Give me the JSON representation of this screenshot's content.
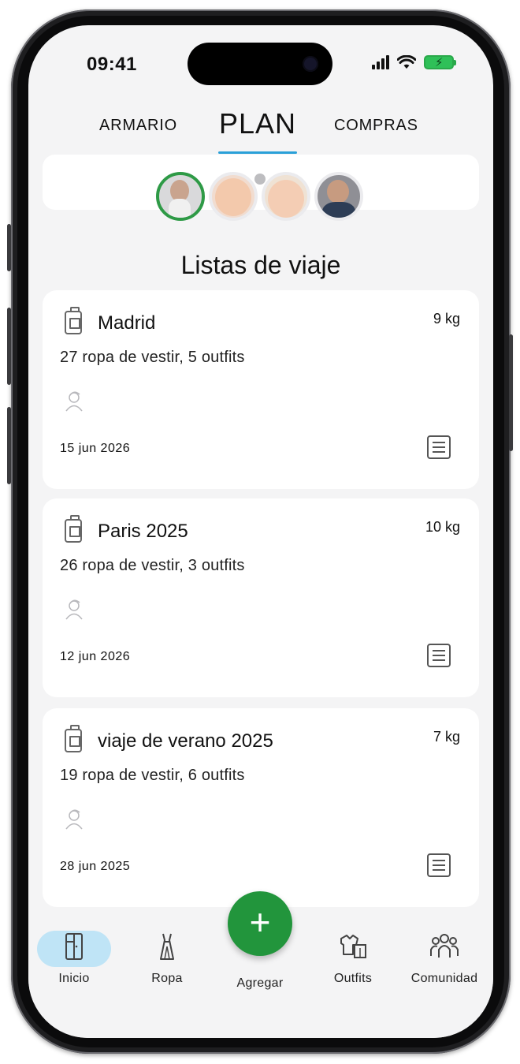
{
  "status_bar": {
    "time": "09:41"
  },
  "tabs": [
    {
      "label": "ARMARIO"
    },
    {
      "label": "PLAN"
    },
    {
      "label": "COMPRAS"
    }
  ],
  "section_title": "Listas de viaje",
  "trips": [
    {
      "name": "Madrid",
      "weight": "9 kg",
      "summary": "27 ropa de vestir, 5 outfits",
      "date": "15 jun 2026"
    },
    {
      "name": "Paris 2025",
      "weight": "10 kg",
      "summary": "26 ropa de vestir, 3 outfits",
      "date": "12 jun 2026"
    },
    {
      "name": "viaje de verano 2025",
      "weight": "7 kg",
      "summary": "19 ropa de vestir, 6 outfits",
      "date": "28 jun 2025"
    }
  ],
  "bottom_nav": {
    "inicio": "Inicio",
    "ropa": "Ropa",
    "agregar": "Agregar",
    "agregar_icon": "+",
    "outfits": "Outfits",
    "comunidad": "Comunidad"
  },
  "colors": {
    "accent_green": "#22953c",
    "tab_underline": "#2aa0d8",
    "active_pill": "#bfe4f6"
  }
}
